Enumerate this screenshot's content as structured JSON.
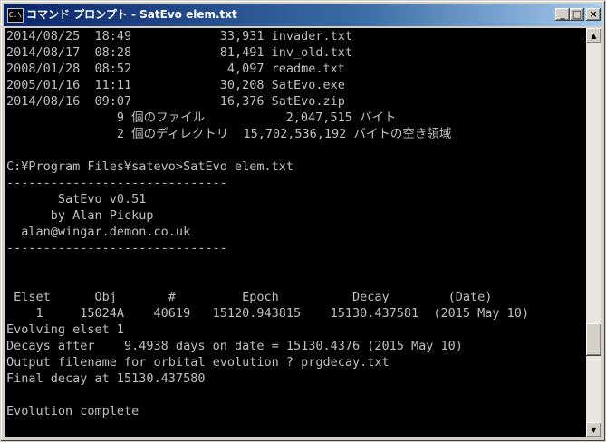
{
  "window": {
    "title": "コマンド プロンプト - SatEvo elem.txt",
    "icon_text": "C:\\",
    "minimize_glyph": "_",
    "maximize_glyph": "□",
    "close_glyph": "×"
  },
  "console": {
    "lines": [
      "2014/08/25  18:49            33,931 invader.txt",
      "2014/08/17  08:28            81,491 inv_old.txt",
      "2008/01/28  08:52             4,097 readme.txt",
      "2005/01/16  11:11            30,208 SatEvo.exe",
      "2014/08/16  09:07            16,376 SatEvo.zip",
      "               9 個のファイル           2,047,515 バイト",
      "               2 個のディレクトリ  15,702,536,192 バイトの空き領域",
      "",
      "C:¥Program Files¥satevo>SatEvo elem.txt",
      "------------------------------",
      "       SatEvo v0.51",
      "      by Alan Pickup",
      "  alan@wingar.demon.co.uk",
      "------------------------------",
      "",
      "",
      "",
      " Elset      Obj       #         Epoch          Decay        (Date)",
      "    1     15024A    40619   15120.943815    15130.437581  (2015 May 10)",
      "Evolving elset 1",
      "Decays after    9.4938 days on date = 15130.4376 (2015 May 10)",
      "Output filename for orbital evolution ? prgdecay.txt",
      "Final decay at 15130.437580",
      "",
      "Evolution complete"
    ]
  },
  "scrollbar": {
    "up_glyph": "▲",
    "down_glyph": "▼"
  }
}
